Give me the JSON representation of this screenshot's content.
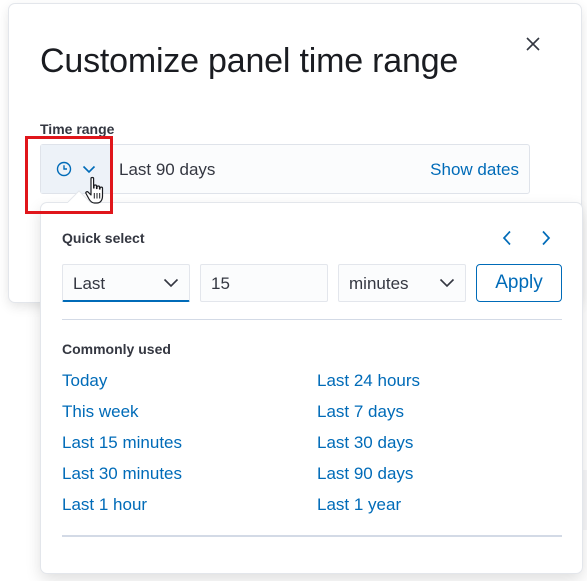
{
  "modal": {
    "title": "Customize panel time range",
    "field_label": "Time range",
    "picker": {
      "range_text": "Last 90 days",
      "show_dates_label": "Show dates"
    }
  },
  "quick_select": {
    "title": "Quick select",
    "direction": "Last",
    "amount": "15",
    "unit": "minutes",
    "apply_label": "Apply"
  },
  "commonly_used": {
    "title": "Commonly used",
    "left": [
      "Today",
      "This week",
      "Last 15 minutes",
      "Last 30 minutes",
      "Last 1 hour"
    ],
    "right": [
      "Last 24 hours",
      "Last 7 days",
      "Last 30 days",
      "Last 90 days",
      "Last 1 year"
    ]
  },
  "colors": {
    "link": "#006bb8",
    "highlight": "#e0161b",
    "text": "#343741"
  },
  "icons": [
    "close-icon",
    "clock-icon",
    "chevron-down-icon",
    "chevron-left-icon",
    "chevron-right-icon",
    "hand-pointer-cursor"
  ]
}
